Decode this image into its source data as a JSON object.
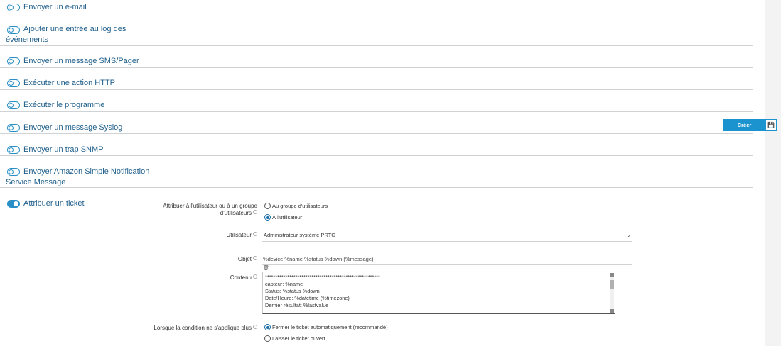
{
  "actions": [
    {
      "label": "Envoyer un e-mail",
      "enabled": false
    },
    {
      "label": "Ajouter une entrée au log des événements",
      "enabled": false
    },
    {
      "label": "Envoyer un message SMS/Pager",
      "enabled": false
    },
    {
      "label": "Exécuter une action HTTP",
      "enabled": false
    },
    {
      "label": "Exécuter le programme",
      "enabled": false
    },
    {
      "label": "Envoyer un message Syslog",
      "enabled": false
    },
    {
      "label": "Envoyer un trap SNMP",
      "enabled": false
    },
    {
      "label": "Envoyer Amazon Simple Notification Service Message",
      "enabled": false
    },
    {
      "label": "Attribuer un ticket",
      "enabled": true
    }
  ],
  "ticket_form": {
    "assign_label_line1": "Attribuer à l'utilisateur ou à un groupe",
    "assign_label_line2": "d'utilisateurs",
    "assign_options": [
      {
        "label": "Au groupe d'utilisateurs",
        "selected": false
      },
      {
        "label": "À l'utilisateur",
        "selected": true
      }
    ],
    "user_label": "Utilisateur",
    "user_value": "Administrateur système PRTG",
    "subject_label": "Objet",
    "subject_value": "%device %name %status %down (%message)",
    "content_label": "Contenu",
    "content_lines": [
      "*********************************************************",
      "capteur: %name",
      "Status: %status %down",
      "",
      "Date/Heure: %datetime (%timezone)",
      "Dernier résultat: %lastvalue"
    ],
    "condition_label": "Lorsque la condition ne s'applique plus",
    "condition_options": [
      {
        "label": "Fermer le ticket automatiquement (recommandé)",
        "selected": true
      },
      {
        "label": "Laisser le ticket ouvert",
        "selected": false
      }
    ]
  },
  "buttons": {
    "create_label": "Créer",
    "save_icon": "save-icon"
  },
  "colors": {
    "accent": "#1a93cf",
    "link_text": "#1f5f8b",
    "divider": "#cfd3d6"
  }
}
